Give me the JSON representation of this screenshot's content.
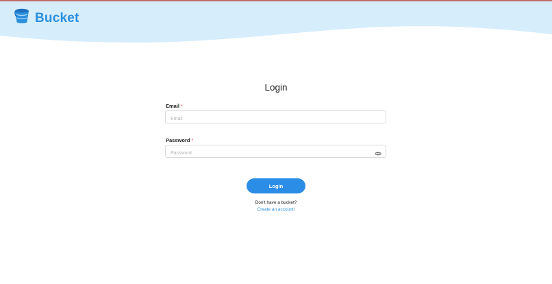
{
  "header": {
    "brand_name": "Bucket",
    "logo_icon": "bucket-icon",
    "accent_color": "#2b8fde",
    "wave_color": "#d6edfc"
  },
  "form": {
    "title": "Login",
    "email": {
      "label": "Email",
      "required_mark": "*",
      "value": "",
      "placeholder": "Email"
    },
    "password": {
      "label": "Password",
      "required_mark": "*",
      "value": "",
      "placeholder": "Password",
      "toggle_icon": "eye-icon"
    },
    "submit_label": "Login",
    "signup_prompt": "Don't have a bucket?",
    "signup_link": "Create an account!"
  }
}
